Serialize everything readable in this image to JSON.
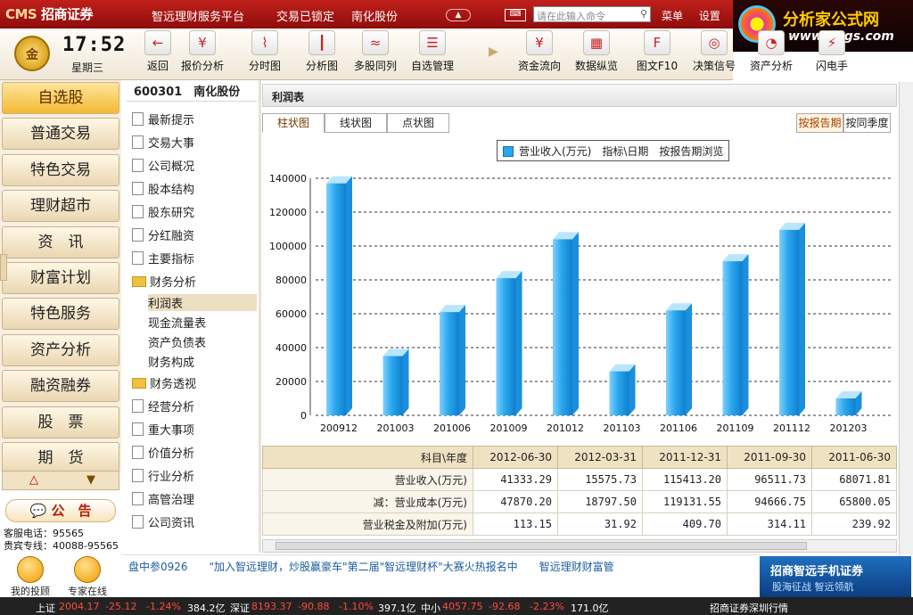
{
  "titlebar": {
    "logo": "CMS",
    "logo_cn": "招商证券",
    "platform": "智远理财服务平台",
    "lock_status": "交易已锁定",
    "stock_name": "南化股份",
    "search_placeholder": "请在此输入命令",
    "menu": "菜单",
    "settings": "设置"
  },
  "brand": {
    "name": "分析家公式网",
    "url": "www.88gs.com"
  },
  "clock": {
    "time": "17:52",
    "weekday": "星期三",
    "badge": "金"
  },
  "toolbar": [
    {
      "label": "返回",
      "icon": "back-arrow-icon",
      "glyph": "←"
    },
    {
      "label": "报价分析",
      "icon": "quote-doc-icon",
      "glyph": "¥"
    },
    {
      "label": "分时图",
      "icon": "timeline-chart-icon",
      "glyph": "⌇"
    },
    {
      "label": "分析图",
      "icon": "candlestick-icon",
      "glyph": "┃"
    },
    {
      "label": "多股同列",
      "icon": "multi-stock-icon",
      "glyph": "≈"
    },
    {
      "label": "自选管理",
      "icon": "watchlist-icon",
      "glyph": "☰"
    },
    {
      "label": "资金流向",
      "icon": "money-flow-icon",
      "glyph": "¥"
    },
    {
      "label": "数据纵览",
      "icon": "data-overview-icon",
      "glyph": "▦"
    },
    {
      "label": "图文F10",
      "icon": "f10-icon",
      "glyph": "F"
    },
    {
      "label": "决策信号",
      "icon": "signal-icon",
      "glyph": "◎"
    },
    {
      "label": "资产分析",
      "icon": "asset-pie-icon",
      "glyph": "◔"
    },
    {
      "label": "闪电手",
      "icon": "lightning-icon",
      "glyph": "⚡"
    }
  ],
  "nav": [
    "自选股",
    "普通交易",
    "特色交易",
    "理财超市",
    "资　讯",
    "财富计划",
    "特色服务",
    "资产分析",
    "融资融券",
    "股　票",
    "期　货"
  ],
  "notice": "公　告",
  "service": {
    "phone": "客服电话：95565",
    "vip": "贵宾专线：40088-95565"
  },
  "avatars": {
    "consult": "我的投顾",
    "expert": "专家在线"
  },
  "stock": {
    "code": "600301",
    "name": "南化股份"
  },
  "tree": [
    {
      "label": "最新提示",
      "type": "doc"
    },
    {
      "label": "交易大事",
      "type": "doc"
    },
    {
      "label": "公司概况",
      "type": "doc"
    },
    {
      "label": "股本结构",
      "type": "doc"
    },
    {
      "label": "股东研究",
      "type": "doc"
    },
    {
      "label": "分红融资",
      "type": "doc"
    },
    {
      "label": "主要指标",
      "type": "doc"
    },
    {
      "label": "财务分析",
      "type": "folder"
    },
    {
      "label": "利润表",
      "type": "sub"
    },
    {
      "label": "现金流量表",
      "type": "sub"
    },
    {
      "label": "资产负债表",
      "type": "sub"
    },
    {
      "label": "财务构成",
      "type": "sub"
    },
    {
      "label": "财务透视",
      "type": "folder"
    },
    {
      "label": "经营分析",
      "type": "doc"
    },
    {
      "label": "重大事项",
      "type": "doc"
    },
    {
      "label": "价值分析",
      "type": "doc"
    },
    {
      "label": "行业分析",
      "type": "doc"
    },
    {
      "label": "高管治理",
      "type": "doc"
    },
    {
      "label": "公司资讯",
      "type": "doc"
    }
  ],
  "pane": {
    "title": "利润表",
    "tabs": [
      "柱状图",
      "线状图",
      "点状图"
    ],
    "right_tabs": [
      "按报告期",
      "按同季度"
    ],
    "legend": "营业收入(万元)　指标\\日期　按报告期浏览"
  },
  "chart_data": {
    "type": "bar",
    "categories": [
      "200912",
      "201003",
      "201006",
      "201009",
      "201012",
      "201103",
      "201106",
      "201109",
      "201112",
      "201203"
    ],
    "series": [
      {
        "name": "营业收入(万元)",
        "values": [
          137000,
          35000,
          61000,
          81000,
          104000,
          26000,
          62000,
          91000,
          109500,
          10000
        ]
      }
    ],
    "ylim": [
      0,
      140000
    ],
    "yticks": [
      "0",
      "20000",
      "40000",
      "60000",
      "80000",
      "100000",
      "120000",
      "140000"
    ],
    "grid": true,
    "color": "#2aa7ee"
  },
  "table": {
    "header": [
      "科目\\年度",
      "2012-06-30",
      "2012-03-31",
      "2011-12-31",
      "2011-09-30",
      "2011-06-30"
    ],
    "rows": [
      [
        "营业收入(万元)",
        "41333.29",
        "15575.73",
        "115413.20",
        "96511.73",
        "68071.81"
      ],
      [
        "减：营业成本(万元)",
        "47870.20",
        "18797.50",
        "119131.55",
        "94666.75",
        "65800.05"
      ],
      [
        "营业税金及附加(万元)",
        "113.15",
        "31.92",
        "409.70",
        "314.11",
        "239.92"
      ]
    ]
  },
  "ticker": "盘中参0926　　\"加入智远理财，炒股赢豪车\"第二届\"智远理财杯\"大赛火热报名中　　智远理财财富管",
  "ad": {
    "title": "招商智远手机证券",
    "sub": "股海征战  智远领航"
  },
  "status": {
    "sh_name": "上证",
    "sh_val": "2004.17",
    "sh_chg": "-25.12",
    "sh_pct": "-1.24%",
    "sh_amt": "384.2亿",
    "sz_name": "深证",
    "sz_val": "8193.37",
    "sz_chg": "-90.88",
    "sz_pct": "-1.10%",
    "sz_amt": "397.1亿",
    "zx_name": "中小",
    "zx_val": "4057.75",
    "zx_chg": "-92.68",
    "zx_pct": "-2.23%",
    "zx_amt": "171.0亿",
    "market": "招商证券深圳行情"
  }
}
